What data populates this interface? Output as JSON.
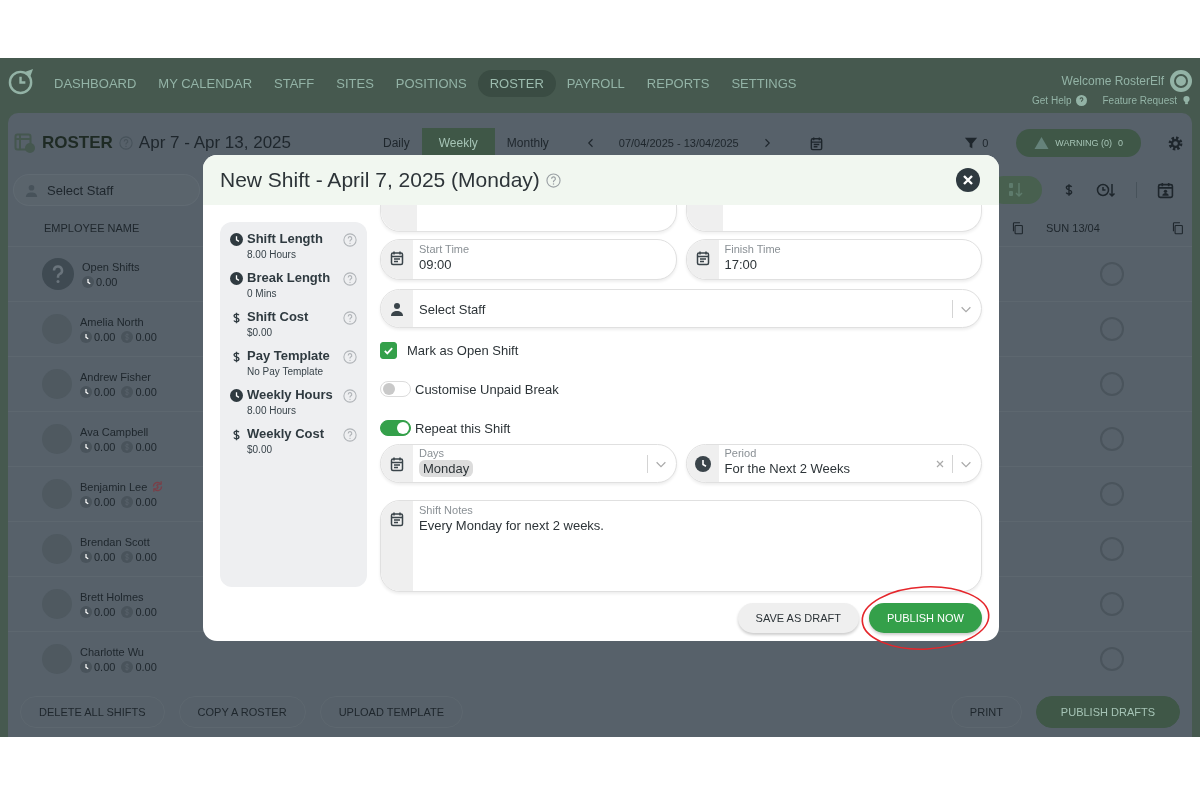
{
  "nav": {
    "items": [
      {
        "label": "DASHBOARD",
        "selected": false
      },
      {
        "label": "MY CALENDAR",
        "selected": false
      },
      {
        "label": "STAFF",
        "selected": false
      },
      {
        "label": "SITES",
        "selected": false
      },
      {
        "label": "POSITIONS",
        "selected": false
      },
      {
        "label": "ROSTER",
        "selected": true
      },
      {
        "label": "PAYROLL",
        "selected": false
      },
      {
        "label": "REPORTS",
        "selected": false
      },
      {
        "label": "SETTINGS",
        "selected": false
      }
    ],
    "welcome": "Welcome RosterElf",
    "links": [
      "Get Help",
      "Feature Request"
    ]
  },
  "roster_header": {
    "title": "ROSTER",
    "date_range": "Apr 7 - Apr 13, 2025",
    "views": [
      {
        "label": "Daily",
        "selected": false
      },
      {
        "label": "Weekly",
        "selected": true
      },
      {
        "label": "Monthly",
        "selected": false
      }
    ],
    "period": "07/04/2025 - 13/04/2025",
    "filter_count": "0",
    "warning": "WARNING (0)",
    "warning_count": "0"
  },
  "staff_filter": {
    "placeholder": "Select Staff"
  },
  "table": {
    "columns": [
      "EMPLOYEE NAME",
      "SUN 13/04"
    ],
    "rows": [
      {
        "kind": "open",
        "name": "Open Shifts",
        "hours": "0.00"
      },
      {
        "kind": "employee",
        "name": "Amelia North",
        "hours": "0.00",
        "cost": "0.00",
        "swap": false
      },
      {
        "kind": "employee",
        "name": "Andrew Fisher",
        "hours": "0.00",
        "cost": "0.00",
        "swap": false
      },
      {
        "kind": "employee",
        "name": "Ava Campbell",
        "hours": "0.00",
        "cost": "0.00",
        "swap": false
      },
      {
        "kind": "employee",
        "name": "Benjamin Lee",
        "hours": "0.00",
        "cost": "0.00",
        "swap": true
      },
      {
        "kind": "employee",
        "name": "Brendan Scott",
        "hours": "0.00",
        "cost": "0.00",
        "swap": false
      },
      {
        "kind": "employee",
        "name": "Brett Holmes",
        "hours": "0.00",
        "cost": "0.00",
        "swap": false
      },
      {
        "kind": "employee",
        "name": "Charlotte Wu",
        "hours": "0.00",
        "cost": "0.00",
        "swap": false
      }
    ]
  },
  "footer": {
    "buttons": [
      {
        "label": "DELETE ALL SHIFTS",
        "kind": "plain"
      },
      {
        "label": "COPY A ROSTER",
        "kind": "plain"
      },
      {
        "label": "UPLOAD TEMPLATE",
        "kind": "plain"
      },
      {
        "label": "PRINT",
        "kind": "plain"
      },
      {
        "label": "PUBLISH DRAFTS",
        "kind": "primary"
      }
    ]
  },
  "modal": {
    "title": "New Shift - April 7, 2025 (Monday)",
    "summary": [
      {
        "kind": "time",
        "label": "Shift Length",
        "value": "8.00 Hours"
      },
      {
        "kind": "time",
        "label": "Break Length",
        "value": "0 Mins"
      },
      {
        "kind": "money",
        "label": "Shift Cost",
        "value": "$0.00"
      },
      {
        "kind": "money",
        "label": "Pay Template",
        "value": "No Pay Template"
      },
      {
        "kind": "time",
        "label": "Weekly Hours",
        "value": "8.00 Hours"
      },
      {
        "kind": "money",
        "label": "Weekly Cost",
        "value": "$0.00"
      }
    ],
    "start_time": {
      "label": "Start Time",
      "value": "09:00"
    },
    "finish_time": {
      "label": "Finish Time",
      "value": "17:00"
    },
    "staff": {
      "placeholder": "Select Staff"
    },
    "open_shift": {
      "label": "Mark as Open Shift",
      "checked": true
    },
    "unpaid_break": {
      "label": "Customise Unpaid Break",
      "on": false
    },
    "repeat": {
      "label": "Repeat this Shift",
      "on": true
    },
    "days": {
      "label": "Days",
      "tags": [
        "Monday"
      ]
    },
    "period": {
      "label": "Period",
      "value": "For the Next 2 Weeks"
    },
    "notes": {
      "label": "Shift Notes",
      "value": "Every Monday for next 2 weeks."
    },
    "buttons": [
      {
        "label": "SAVE AS DRAFT",
        "kind": "secondary",
        "annotated": false
      },
      {
        "label": "PUBLISH NOW",
        "kind": "primary",
        "annotated": true
      }
    ]
  }
}
